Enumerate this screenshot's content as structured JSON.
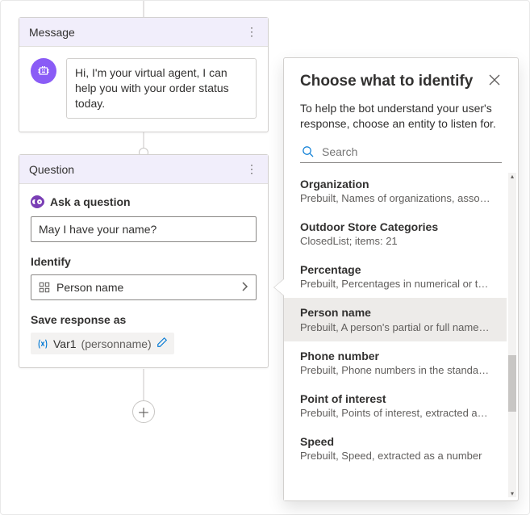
{
  "message_card": {
    "title": "Message",
    "bot_text": "Hi, I'm your virtual agent, I can help you with your order status today."
  },
  "question_card": {
    "title": "Question",
    "ask_label": "Ask a question",
    "question_text": "May I have your name?",
    "identify_label": "Identify",
    "identify_value": "Person name",
    "save_label": "Save response as",
    "var_name": "Var1",
    "var_type": "(personname)"
  },
  "flyout": {
    "title": "Choose what to identify",
    "subtitle": "To help the bot understand your user's response, choose an entity to listen for.",
    "search_placeholder": "Search",
    "selected_index": 3,
    "entities": [
      {
        "name": "Organization",
        "desc": "Prebuilt, Names of organizations, associations.."
      },
      {
        "name": "Outdoor Store Categories",
        "desc": "ClosedList; items: 21"
      },
      {
        "name": "Percentage",
        "desc": "Prebuilt, Percentages in numerical or text for..."
      },
      {
        "name": "Person name",
        "desc": "Prebuilt, A person's partial or full name, extra.."
      },
      {
        "name": "Phone number",
        "desc": "Prebuilt, Phone numbers in the standard US f.."
      },
      {
        "name": "Point of interest",
        "desc": "Prebuilt, Points of interest, extracted as a string"
      },
      {
        "name": "Speed",
        "desc": "Prebuilt, Speed, extracted as a number"
      }
    ]
  }
}
